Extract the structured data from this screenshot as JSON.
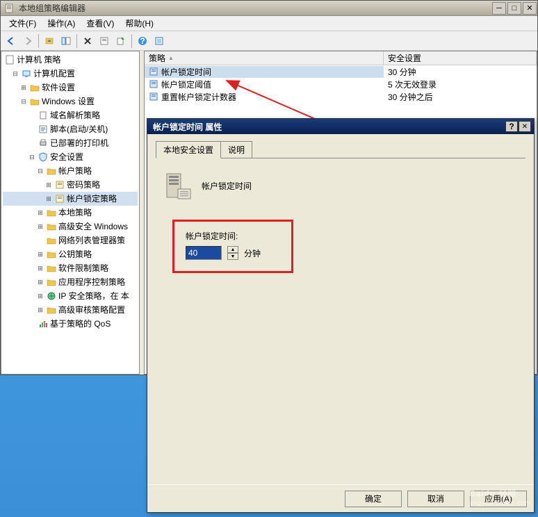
{
  "main_window": {
    "title": "本地组策略编辑器",
    "menu": [
      "文件(F)",
      "操作(A)",
      "查看(V)",
      "帮助(H)"
    ]
  },
  "tree": {
    "root": "计算机 策略",
    "items": [
      {
        "indent": 1,
        "exp": "-",
        "icon": "computer",
        "label": "计算机配置"
      },
      {
        "indent": 2,
        "exp": "+",
        "icon": "folder",
        "label": "软件设置"
      },
      {
        "indent": 2,
        "exp": "-",
        "icon": "folder",
        "label": "Windows 设置"
      },
      {
        "indent": 3,
        "exp": "",
        "icon": "file",
        "label": "域名解析策略"
      },
      {
        "indent": 3,
        "exp": "",
        "icon": "script",
        "label": "脚本(启动/关机)"
      },
      {
        "indent": 3,
        "exp": "",
        "icon": "printer",
        "label": "已部署的打印机"
      },
      {
        "indent": 3,
        "exp": "-",
        "icon": "shield",
        "label": "安全设置"
      },
      {
        "indent": 4,
        "exp": "-",
        "icon": "folder",
        "label": "帐户策略"
      },
      {
        "indent": 5,
        "exp": "+",
        "icon": "policy",
        "label": "密码策略"
      },
      {
        "indent": 5,
        "exp": "+",
        "icon": "policy",
        "label": "帐户锁定策略",
        "selected": true
      },
      {
        "indent": 4,
        "exp": "+",
        "icon": "folder",
        "label": "本地策略"
      },
      {
        "indent": 4,
        "exp": "+",
        "icon": "folder",
        "label": "高级安全 Windows"
      },
      {
        "indent": 4,
        "exp": "",
        "icon": "folder",
        "label": "网络列表管理器策"
      },
      {
        "indent": 4,
        "exp": "+",
        "icon": "folder",
        "label": "公钥策略"
      },
      {
        "indent": 4,
        "exp": "+",
        "icon": "folder",
        "label": "软件限制策略"
      },
      {
        "indent": 4,
        "exp": "+",
        "icon": "folder",
        "label": "应用程序控制策略"
      },
      {
        "indent": 4,
        "exp": "+",
        "icon": "ipsec",
        "label": "IP 安全策略，在 本"
      },
      {
        "indent": 4,
        "exp": "+",
        "icon": "folder",
        "label": "高级审核策略配置"
      },
      {
        "indent": 3,
        "exp": "",
        "icon": "qos",
        "label": "基于策略的 QoS"
      }
    ]
  },
  "list": {
    "columns": {
      "c0": "策略",
      "c1": "安全设置"
    },
    "rows": [
      {
        "name": "帐户锁定时间",
        "value": "30 分钟",
        "sel": true
      },
      {
        "name": "帐户锁定阈值",
        "value": "5 次无效登录"
      },
      {
        "name": "重置帐户锁定计数器",
        "value": "30 分钟之后"
      }
    ]
  },
  "dialog": {
    "title": "帐户锁定时间 属性",
    "tabs": {
      "t0": "本地安全设置",
      "t1": "说明"
    },
    "prop_name": "帐户锁定时间",
    "field_label": "帐户锁定时间:",
    "value": "40",
    "unit": "分钟",
    "buttons": {
      "ok": "确定",
      "cancel": "取消",
      "apply": "应用(A)"
    }
  },
  "watermark": {
    "main": "Baidu 经验",
    "sub": "jingyan.baidu.com"
  }
}
